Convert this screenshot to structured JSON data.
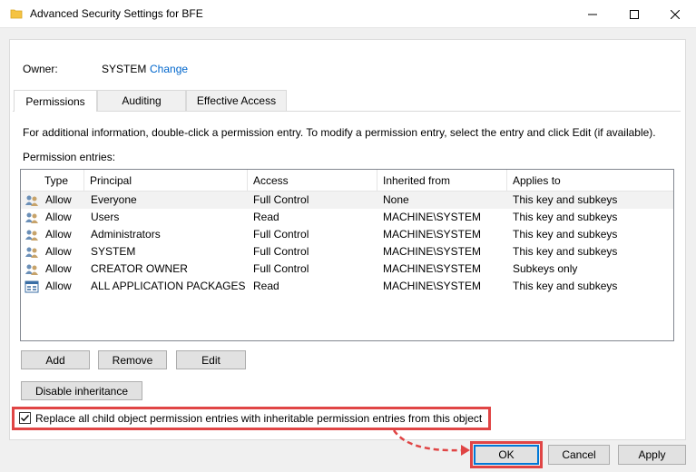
{
  "window": {
    "title": "Advanced Security Settings for BFE"
  },
  "owner": {
    "label": "Owner:",
    "value": "SYSTEM",
    "change_link": "Change"
  },
  "tabs": [
    {
      "label": "Permissions",
      "active": true
    },
    {
      "label": "Auditing",
      "active": false
    },
    {
      "label": "Effective Access",
      "active": false
    }
  ],
  "info_text": "For additional information, double-click a permission entry. To modify a permission entry, select the entry and click Edit (if available).",
  "entries_label": "Permission entries:",
  "columns": [
    "Type",
    "Principal",
    "Access",
    "Inherited from",
    "Applies to"
  ],
  "entries": [
    {
      "icon": "users-group-icon",
      "type": "Allow",
      "principal": "Everyone",
      "access": "Full Control",
      "inherited_from": "None",
      "applies_to": "This key and subkeys",
      "selected": true
    },
    {
      "icon": "users-group-icon",
      "type": "Allow",
      "principal": "Users",
      "access": "Read",
      "inherited_from": "MACHINE\\SYSTEM",
      "applies_to": "This key and subkeys",
      "selected": false
    },
    {
      "icon": "users-group-icon",
      "type": "Allow",
      "principal": "Administrators",
      "access": "Full Control",
      "inherited_from": "MACHINE\\SYSTEM",
      "applies_to": "This key and subkeys",
      "selected": false
    },
    {
      "icon": "users-group-icon",
      "type": "Allow",
      "principal": "SYSTEM",
      "access": "Full Control",
      "inherited_from": "MACHINE\\SYSTEM",
      "applies_to": "This key and subkeys",
      "selected": false
    },
    {
      "icon": "users-group-icon",
      "type": "Allow",
      "principal": "CREATOR OWNER",
      "access": "Full Control",
      "inherited_from": "MACHINE\\SYSTEM",
      "applies_to": "Subkeys only",
      "selected": false
    },
    {
      "icon": "app-packages-icon",
      "type": "Allow",
      "principal": "ALL APPLICATION PACKAGES",
      "access": "Read",
      "inherited_from": "MACHINE\\SYSTEM",
      "applies_to": "This key and subkeys",
      "selected": false
    }
  ],
  "buttons": {
    "add": "Add",
    "remove": "Remove",
    "edit": "Edit",
    "disable_inheritance": "Disable inheritance",
    "ok": "OK",
    "cancel": "Cancel",
    "apply": "Apply"
  },
  "replace_checkbox": {
    "label": "Replace all child object permission entries with inheritable permission entries from this object",
    "checked": true
  },
  "colors": {
    "link": "#0066cc",
    "highlight": "#e04545",
    "focus": "#0078d7"
  }
}
